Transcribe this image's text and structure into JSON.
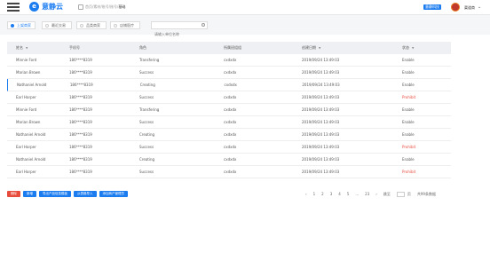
{
  "header": {
    "logo_glyph": "e",
    "logo_text": "意静云",
    "breadcrumb_prefix": "首页/素材/账号/账号/",
    "breadcrumb_current": "基础",
    "badge": "意静科技",
    "user_name": "渠道商",
    "accent": "#1b7cf0"
  },
  "filters": {
    "tabs": [
      "上架商家",
      "最近交易",
      "品类商家",
      "店铺医疗"
    ],
    "search_placeholder": "请输入单位名称"
  },
  "table": {
    "columns": [
      "姓名",
      "手机号",
      "角色",
      "所属班组组",
      "创建日期",
      "状态"
    ],
    "rows": [
      {
        "name": "Minnie Ford",
        "phone": "186****8319",
        "role": "Transfering",
        "group": "cxdxdx",
        "date": "2019/09/24 13:49:03",
        "status": "Enable"
      },
      {
        "name": "Marian Brown",
        "phone": "186****8319",
        "role": "Success",
        "group": "cxdxdx",
        "date": "2019/09/24 13:49:03",
        "status": "Enable"
      },
      {
        "name": "Nathaniel Arnold",
        "phone": "186****8319",
        "role": "Creating",
        "group": "cxdxdx",
        "date": "2019/09/24 13:49:03",
        "status": "Enable"
      },
      {
        "name": "Earl Harper",
        "phone": "186****8319",
        "role": "Success",
        "group": "cxdxdx",
        "date": "2019/09/24 13:49:03",
        "status": "Prohibit"
      },
      {
        "name": "Minnie Ford",
        "phone": "186****8319",
        "role": "Transfering",
        "group": "cxdxdx",
        "date": "2019/09/24 13:49:03",
        "status": "Enable"
      },
      {
        "name": "Marian Brown",
        "phone": "186****8319",
        "role": "Success",
        "group": "cxdxdx",
        "date": "2019/09/24 13:49:03",
        "status": "Enable"
      },
      {
        "name": "Nathaniel Arnold",
        "phone": "186****8319",
        "role": "Creating",
        "group": "cxdxdx",
        "date": "2019/09/24 13:49:03",
        "status": "Enable"
      },
      {
        "name": "Earl Harper",
        "phone": "186****8319",
        "role": "Success",
        "group": "cxdxdx",
        "date": "2019/09/24 13:49:03",
        "status": "Prohibit"
      },
      {
        "name": "Nathaniel Arnold",
        "phone": "186****8319",
        "role": "Creating",
        "group": "cxdxdx",
        "date": "2019/09/24 13:49:03",
        "status": "Enable"
      },
      {
        "name": "Earl Harper",
        "phone": "186****8319",
        "role": "Success",
        "group": "cxdxdx",
        "date": "2019/09/24 13:49:03",
        "status": "Prohibit"
      }
    ],
    "status_colors": {
      "Enable": "#555555",
      "Prohibit": "#e74c3c"
    }
  },
  "actions": [
    "删除",
    "新增",
    "导出产品信息模板",
    "从表格导入",
    "添加商户管理员"
  ],
  "pagination": {
    "prev": "‹",
    "pages": [
      "1",
      "2",
      "3",
      "4",
      "5",
      "...",
      "23"
    ],
    "next": "›",
    "goto_label": "跳至",
    "page_unit": "页",
    "total": "共99条数据"
  }
}
